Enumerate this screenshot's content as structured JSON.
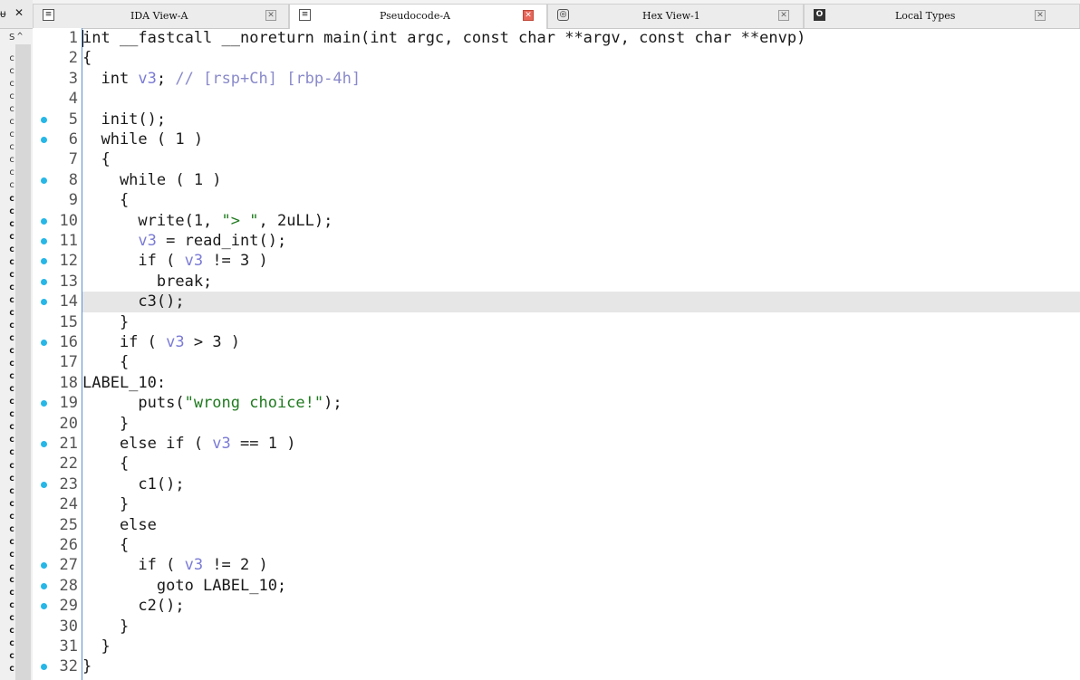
{
  "left_panel": {
    "pin_glyph": "ᵾ",
    "close_glyph": "✕",
    "sort_glyph": "S",
    "items": [
      "c",
      "c",
      "c",
      "c",
      "c",
      "c",
      "c",
      "c",
      "c",
      "c",
      "c",
      "c",
      "c",
      "c",
      "c",
      "c",
      "c",
      "c",
      "c",
      "c",
      "c",
      "c",
      "c",
      "c",
      "c",
      "c",
      "c",
      "c",
      "c",
      "c",
      "c",
      "c",
      "c",
      "c",
      "c",
      "c",
      "c",
      "c",
      "c",
      "c",
      "c",
      "c",
      "c",
      "c",
      "c",
      "c",
      "c",
      "c",
      "c"
    ]
  },
  "tabs": [
    {
      "label": "IDA View-A",
      "icon": "ida-view-icon",
      "active": false
    },
    {
      "label": "Pseudocode-A",
      "icon": "pseudocode-icon",
      "active": true
    },
    {
      "label": "Hex View-1",
      "icon": "hex-view-icon",
      "active": false
    },
    {
      "label": "Local Types",
      "icon": "local-types-icon",
      "active": false
    }
  ],
  "colors": {
    "keyword": "#1a1a1a",
    "variable": "#7b7bd6",
    "comment": "#8a8acb",
    "string": "#1f7a1f",
    "number": "#1a1a1a",
    "breakpoint_dot": "#26b7e7",
    "highlight_line": "#e6e6e6"
  },
  "code": {
    "highlighted_line": 14,
    "lines": [
      {
        "n": "1",
        "dot": false,
        "text": "int __fastcall __noreturn main(int argc, const char **argv, const char **envp)"
      },
      {
        "n": "2",
        "dot": false,
        "text": "{"
      },
      {
        "n": "3",
        "dot": false,
        "text": "  int v3; // [rsp+Ch] [rbp-4h]"
      },
      {
        "n": "4",
        "dot": false,
        "text": ""
      },
      {
        "n": "5",
        "dot": true,
        "text": "  init();"
      },
      {
        "n": "6",
        "dot": true,
        "text": "  while ( 1 )"
      },
      {
        "n": "7",
        "dot": false,
        "text": "  {"
      },
      {
        "n": "8",
        "dot": true,
        "text": "    while ( 1 )"
      },
      {
        "n": "9",
        "dot": false,
        "text": "    {"
      },
      {
        "n": "10",
        "dot": true,
        "text": "      write(1, \"> \", 2uLL);"
      },
      {
        "n": "11",
        "dot": true,
        "text": "      v3 = read_int();"
      },
      {
        "n": "12",
        "dot": true,
        "text": "      if ( v3 != 3 )"
      },
      {
        "n": "13",
        "dot": true,
        "text": "        break;"
      },
      {
        "n": "14",
        "dot": true,
        "text": "      c3();"
      },
      {
        "n": "15",
        "dot": false,
        "text": "    }"
      },
      {
        "n": "16",
        "dot": true,
        "text": "    if ( v3 > 3 )"
      },
      {
        "n": "17",
        "dot": false,
        "text": "    {"
      },
      {
        "n": "18",
        "dot": false,
        "text": "LABEL_10:"
      },
      {
        "n": "19",
        "dot": true,
        "text": "      puts(\"wrong choice!\");"
      },
      {
        "n": "20",
        "dot": false,
        "text": "    }"
      },
      {
        "n": "21",
        "dot": true,
        "text": "    else if ( v3 == 1 )"
      },
      {
        "n": "22",
        "dot": false,
        "text": "    {"
      },
      {
        "n": "23",
        "dot": true,
        "text": "      c1();"
      },
      {
        "n": "24",
        "dot": false,
        "text": "    }"
      },
      {
        "n": "25",
        "dot": false,
        "text": "    else"
      },
      {
        "n": "26",
        "dot": false,
        "text": "    {"
      },
      {
        "n": "27",
        "dot": true,
        "text": "      if ( v3 != 2 )"
      },
      {
        "n": "28",
        "dot": true,
        "text": "        goto LABEL_10;"
      },
      {
        "n": "29",
        "dot": true,
        "text": "      c2();"
      },
      {
        "n": "30",
        "dot": false,
        "text": "    }"
      },
      {
        "n": "31",
        "dot": false,
        "text": "  }"
      },
      {
        "n": "32",
        "dot": true,
        "text": "}"
      }
    ]
  }
}
